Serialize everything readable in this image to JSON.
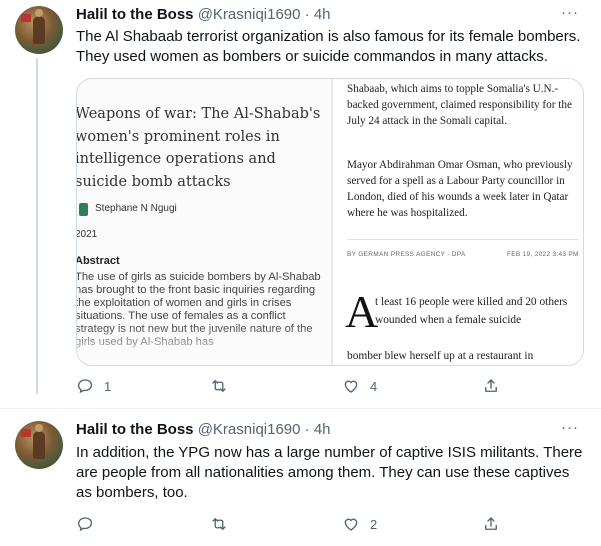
{
  "tweets": [
    {
      "name": "Halil to the Boss",
      "handle": "@Krasniqi1690",
      "separator": "·",
      "time": "4h",
      "text": "The Al Shabaab terrorist organization is also famous for its female bombers. They used women as bombers or suicide commandos in many attacks.",
      "media": {
        "paper_title": "Weapons of war: The Al-Shabab's women's prominent roles in intelligence operations and suicide bomb attacks",
        "paper_author": "Stephane N Ngugi",
        "paper_year": "2021",
        "paper_abstract_heading": "Abstract",
        "paper_abstract": "The use of girls as suicide bombers by Al-Shabab has brought to the front basic inquiries regarding the exploitation of women and girls in crises situations. The use of females as a conflict strategy is not new but the juvenile nature of the girls used by Al-Shabab has",
        "news_top": "Shabaab, which aims to topple Somalia's U.N.-backed government, claimed responsibility for the July 24 attack in the Somali capital.",
        "news_mid": "Mayor Abdirahman Omar Osman, who previously served for a spell as a Labour Party councillor in London, died of his wounds a week later in Qatar where he was hospitalized.",
        "news_byline": "BY GERMAN PRESS AGENCY - DPA",
        "news_date": "FEB 19, 2022 3:43 PM",
        "news_dropcap": "A",
        "news_body": "t least 16 people were killed and 20 others wounded when a female suicide",
        "news_body2": "bomber blew herself up at a restaurant in Beledwayne, the regional capital of Hiiraan"
      },
      "actions": {
        "replies": "1",
        "retweets": "",
        "likes": "4"
      }
    },
    {
      "name": "Halil to the Boss",
      "handle": "@Krasniqi1690",
      "separator": "·",
      "time": "4h",
      "text": "In addition, the YPG now has a large number of captive ISIS militants. There are people from all nationalities among them. They can use these captives as bombers, too.",
      "actions": {
        "replies": "",
        "retweets": "",
        "likes": "2"
      }
    }
  ],
  "more_label": "···",
  "icons": [
    "reply-icon",
    "retweet-icon",
    "like-icon",
    "share-icon",
    "more-icon"
  ],
  "colors": {
    "text": "#0f1419",
    "secondary": "#536471",
    "border": "#cfd9de"
  }
}
